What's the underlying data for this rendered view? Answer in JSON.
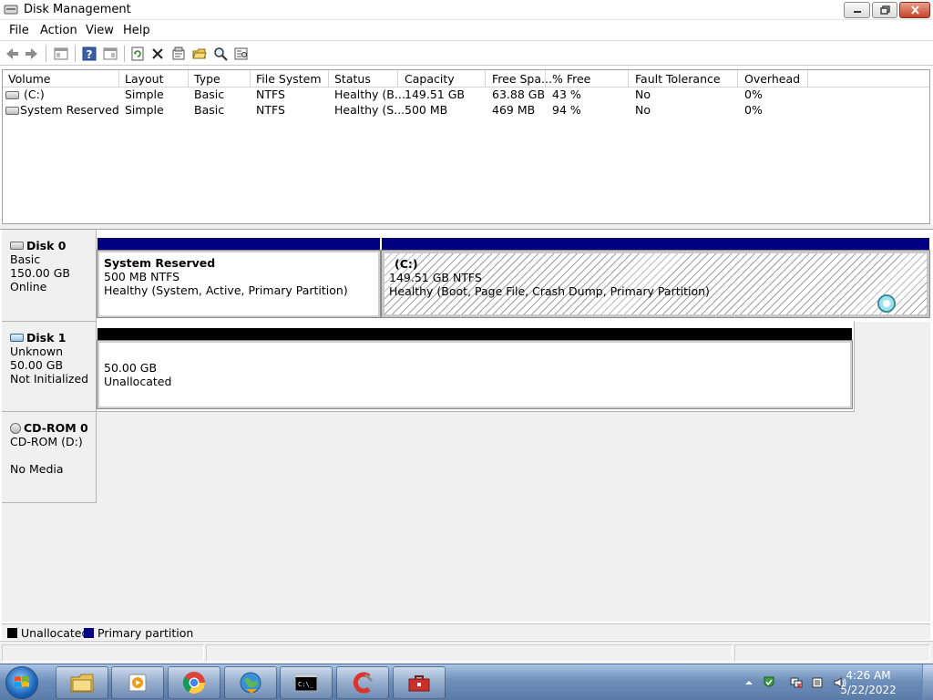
{
  "window": {
    "title": "Disk Management",
    "icon": "disk-management-icon",
    "controls": {
      "minimize": "minimize-icon",
      "maximize": "maximize-icon",
      "close": "close-icon"
    }
  },
  "menu": {
    "items": [
      "File",
      "Action",
      "View",
      "Help"
    ]
  },
  "toolbar": {
    "buttons": [
      "back-icon",
      "forward-icon",
      "show-hide-console-tree-icon",
      "help-icon",
      "show-hide-action-pane-icon",
      "refresh-icon",
      "delete-icon",
      "properties-icon",
      "open-icon",
      "rescan-disks-icon",
      "settings-icon"
    ]
  },
  "volume_list": {
    "columns": [
      "Volume",
      "Layout",
      "Type",
      "File System",
      "Status",
      "Capacity",
      "Free Spa...",
      "% Free",
      "Fault Tolerance",
      "Overhead"
    ],
    "rows": [
      {
        "volume": "(C:)",
        "layout": "Simple",
        "type": "Basic",
        "fs": "NTFS",
        "status": "Healthy (B...",
        "capacity": "149.51 GB",
        "free": "63.88 GB",
        "pct": "43 %",
        "fault": "No",
        "overhead": "0%"
      },
      {
        "volume": "System Reserved",
        "layout": "Simple",
        "type": "Basic",
        "fs": "NTFS",
        "status": "Healthy (S...",
        "capacity": "500 MB",
        "free": "469 MB",
        "pct": "94 %",
        "fault": "No",
        "overhead": "0%"
      }
    ]
  },
  "disks": [
    {
      "name": "Disk 0",
      "type": "Basic",
      "size": "150.00 GB",
      "state": "Online",
      "icon": "hard-disk-icon",
      "partitions": [
        {
          "name": "System Reserved",
          "size_fs": "500 MB NTFS",
          "status": "Healthy (System, Active, Primary Partition)",
          "kind": "Primary partition"
        },
        {
          "name": "(C:)",
          "size_fs": "149.51 GB NTFS",
          "status": "Healthy (Boot, Page File, Crash Dump, Primary Partition)",
          "kind": "Primary partition"
        }
      ]
    },
    {
      "name": "Disk 1",
      "type": "Unknown",
      "size": "50.00 GB",
      "state": "Not Initialized",
      "icon": "uninitialized-disk-icon",
      "partitions": [
        {
          "size": "50.00 GB",
          "status": "Unallocated",
          "kind": "Unallocated"
        }
      ]
    },
    {
      "name": "CD-ROM 0",
      "type": "CD-ROM (D:)",
      "state": "No Media",
      "icon": "cdrom-icon"
    }
  ],
  "legend": [
    {
      "label": "Unallocated",
      "color": "#000000"
    },
    {
      "label": "Primary partition",
      "color": "#000080"
    }
  ],
  "colors": {
    "primary_partition": "#000080",
    "unallocated": "#000000"
  },
  "taskbar": {
    "buttons": [
      "file-explorer-icon",
      "media-player-icon",
      "chrome-icon",
      "network-globe-icon",
      "command-prompt-icon",
      "ccleaner-icon",
      "toolbox-icon"
    ],
    "tray": [
      "show-hidden-icons-icon",
      "action-center-icon",
      "network-icon",
      "volume-icon"
    ],
    "time": "4:26 AM",
    "date": "5/22/2022"
  }
}
